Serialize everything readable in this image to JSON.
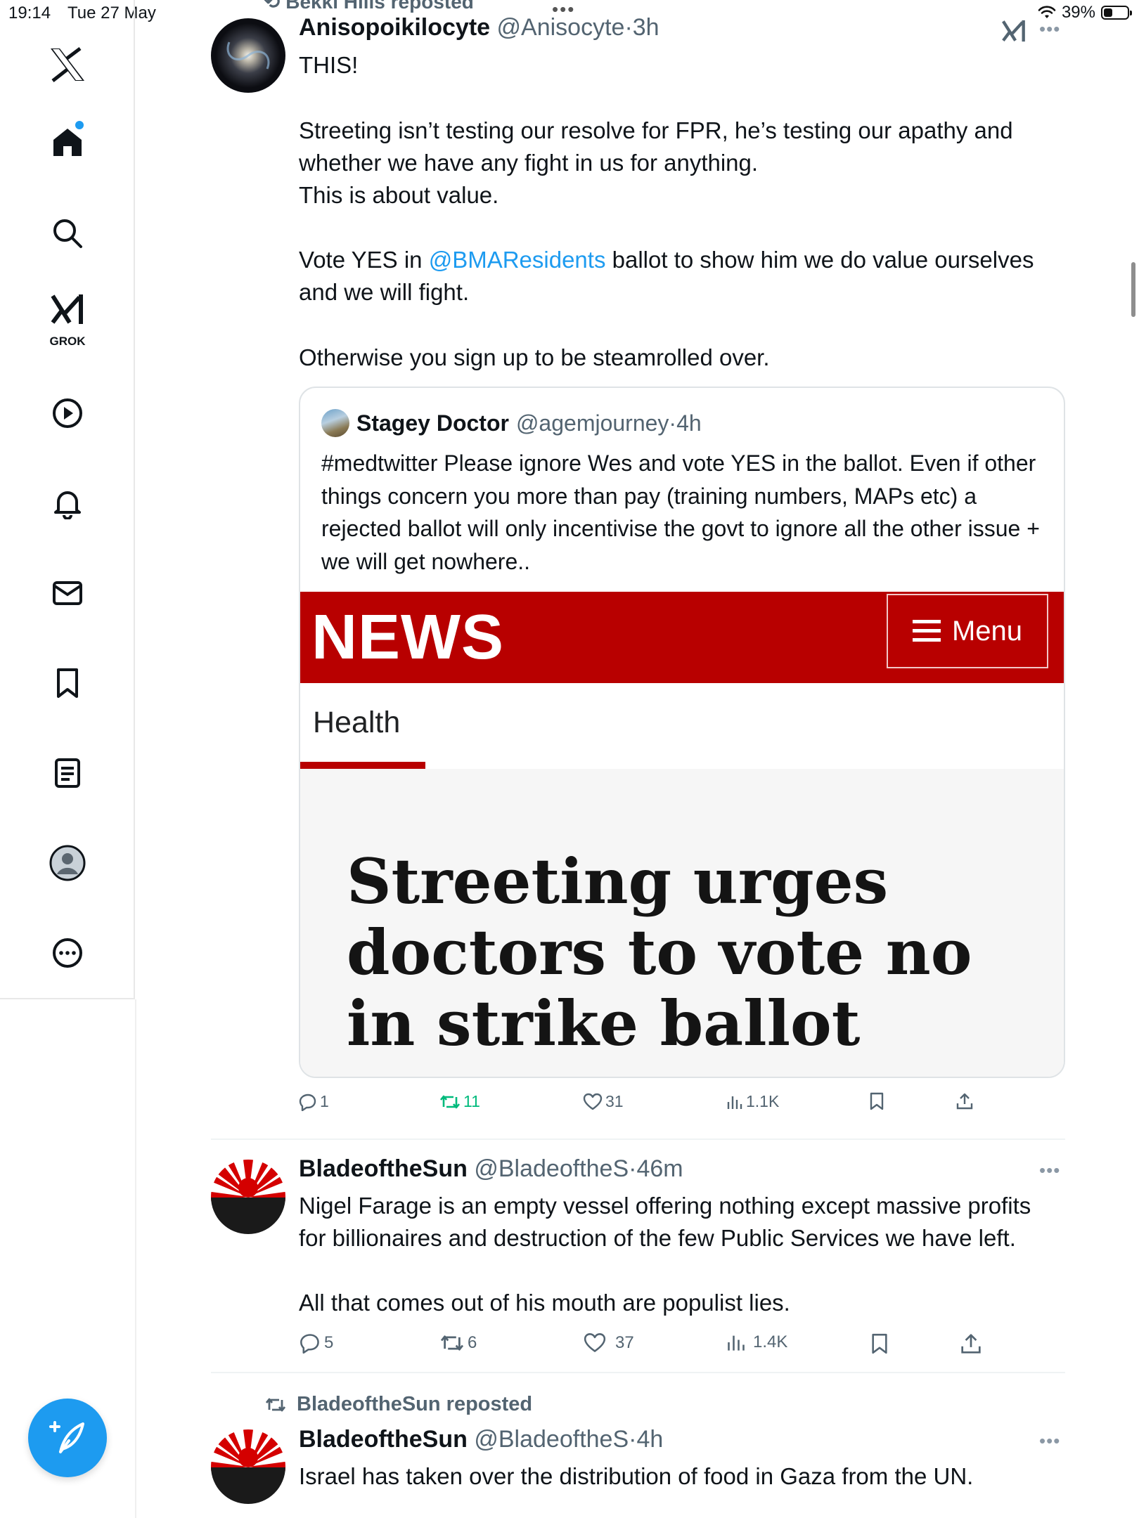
{
  "status_bar": {
    "time": "19:14",
    "date": "Tue 27 May",
    "battery": "39%",
    "battery_level": 0.39
  },
  "sidebar": {
    "logo_icon": "x-logo-icon",
    "items": [
      {
        "name": "home",
        "icon": "home-icon",
        "badge": true
      },
      {
        "name": "explore",
        "icon": "search-icon"
      },
      {
        "name": "grok",
        "icon": "grok-icon",
        "label": "GROK"
      },
      {
        "name": "video",
        "icon": "play-icon"
      },
      {
        "name": "notifications",
        "icon": "bell-icon"
      },
      {
        "name": "messages",
        "icon": "mail-icon"
      },
      {
        "name": "bookmarks",
        "icon": "bookmark-icon"
      },
      {
        "name": "lists",
        "icon": "list-icon"
      },
      {
        "name": "profile",
        "icon": "profile-icon"
      },
      {
        "name": "more",
        "icon": "more-icon"
      }
    ],
    "compose_icon": "compose-icon"
  },
  "top_repost": "Bekki Hills reposted",
  "tweets": [
    {
      "name": "Anisopoikilocyte",
      "handle": "@Anisocyte",
      "time": "3h",
      "para1": "THIS!",
      "para2": "Streeting isn’t testing our resolve for FPR, he’s testing our apathy and\nwhether we have any fight in us for anything.\nThis is about value.",
      "para3_before": "Vote YES in ",
      "para3_mention": "@BMAResidents",
      "para3_after": " ballot to show him we do value ourselves\nand we will fight.",
      "para4": "Otherwise you sign up to be steamrolled over.",
      "quote": {
        "name": "Stagey Doctor",
        "handle": "@agemjourney",
        "time": "4h",
        "text": "#medtwitter Please ignore Wes and vote YES in the ballot. Even if other things concern you more than pay (training numbers, MAPs etc) a rejected ballot will only incentivise the govt to ignore all the other issue + we will get nowhere..",
        "media": {
          "brand": "NEWS",
          "menu_label": "Menu",
          "section": "Health",
          "headline": "Streeting urges doctors to vote no in strike ballot"
        }
      },
      "stats": {
        "replies": "1",
        "reposts": "11",
        "likes": "31",
        "views": "1.1K"
      }
    },
    {
      "name": "BladeoftheSun",
      "handle": "@BladeoftheS",
      "time": "46m",
      "para1": "Nigel Farage is an empty vessel offering nothing except massive profits\nfor billionaires and destruction of the few Public Services we have left.",
      "para2": "All that comes out of his mouth are populist lies.",
      "stats": {
        "replies": "5",
        "reposts": "6",
        "likes": "37",
        "views": "1.4K"
      }
    },
    {
      "repost_label": "BladeoftheSun reposted",
      "name": "BladeoftheSun",
      "handle": "@BladeoftheS",
      "time": "4h",
      "para1": "Israel has taken over the distribution of food in Gaza from the UN."
    }
  ],
  "separator": "·",
  "colors": {
    "accent": "#1d9bf0",
    "bbc_red": "#b80000",
    "secondary_text": "#536471",
    "repost_green": "#00ba7c"
  }
}
